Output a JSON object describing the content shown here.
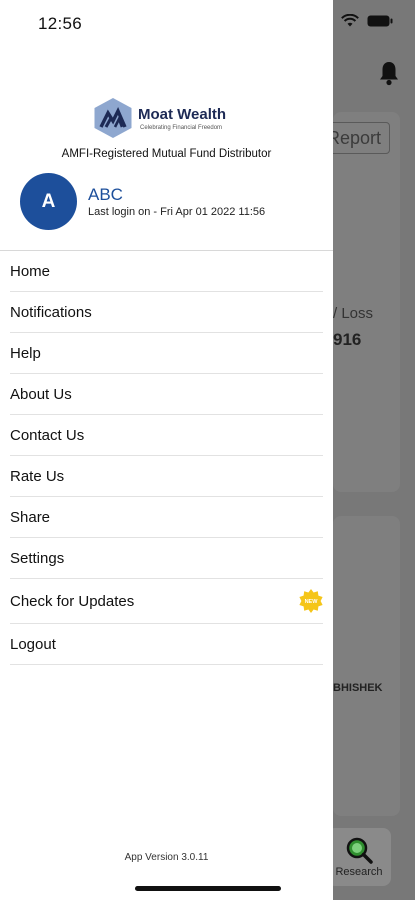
{
  "status_bar": {
    "time": "12:56"
  },
  "brand": {
    "name": "Moat Wealth",
    "tagline": "Celebrating Financial Freedom",
    "subtitle": "AMFI-Registered Mutual Fund Distributor"
  },
  "user": {
    "avatar_letter": "A",
    "name": "ABC",
    "last_login": "Last login on - Fri Apr 01 2022 11:56"
  },
  "menu": {
    "items": [
      {
        "label": "Home"
      },
      {
        "label": "Notifications"
      },
      {
        "label": "Help"
      },
      {
        "label": "About Us"
      },
      {
        "label": "Contact Us"
      },
      {
        "label": "Rate Us"
      },
      {
        "label": "Share"
      },
      {
        "label": "Settings"
      },
      {
        "label": "Check for Updates",
        "badge": "NEW"
      },
      {
        "label": "Logout"
      }
    ]
  },
  "footer": {
    "app_version": "App Version 3.0.11"
  },
  "background": {
    "report_button": "Report",
    "pl_label": "/ Loss",
    "pl_value": "916",
    "name_fragment": "BHISHEK",
    "research_label": "Research"
  },
  "colors": {
    "brand_blue": "#1d4f9b",
    "brand_dark": "#1d2a55",
    "badge_yellow": "#f5c518",
    "overlay": "#787878"
  }
}
